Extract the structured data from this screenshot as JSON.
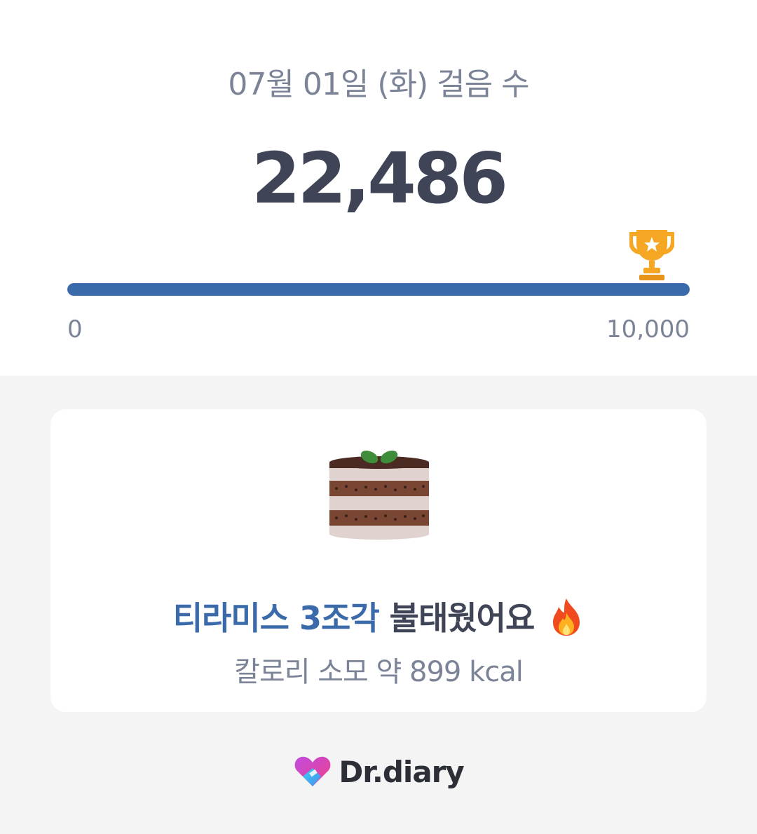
{
  "step_summary": {
    "date_label": "07월 01일 (화) 걸음 수",
    "steps": "22,486",
    "goal_progress": 1.0,
    "scale_min": "0",
    "scale_max": "10,000",
    "goal_icon": "trophy-icon"
  },
  "calorie_card": {
    "image_icon": "tiramisu-cake-icon",
    "highlight": "티라미스 3조각",
    "message": " 불태웠어요",
    "emoji_icon": "fire-icon",
    "calorie_text": "칼로리 소모 약 899 kcal"
  },
  "brand": {
    "logo_icon": "heart-logo-icon",
    "name": "Dr.diary"
  },
  "colors": {
    "accent": "#3a6aaa",
    "text_dark": "#3f4556",
    "text_muted": "#7b8396",
    "background": "#f4f4f4",
    "trophy": "#f5a623"
  }
}
